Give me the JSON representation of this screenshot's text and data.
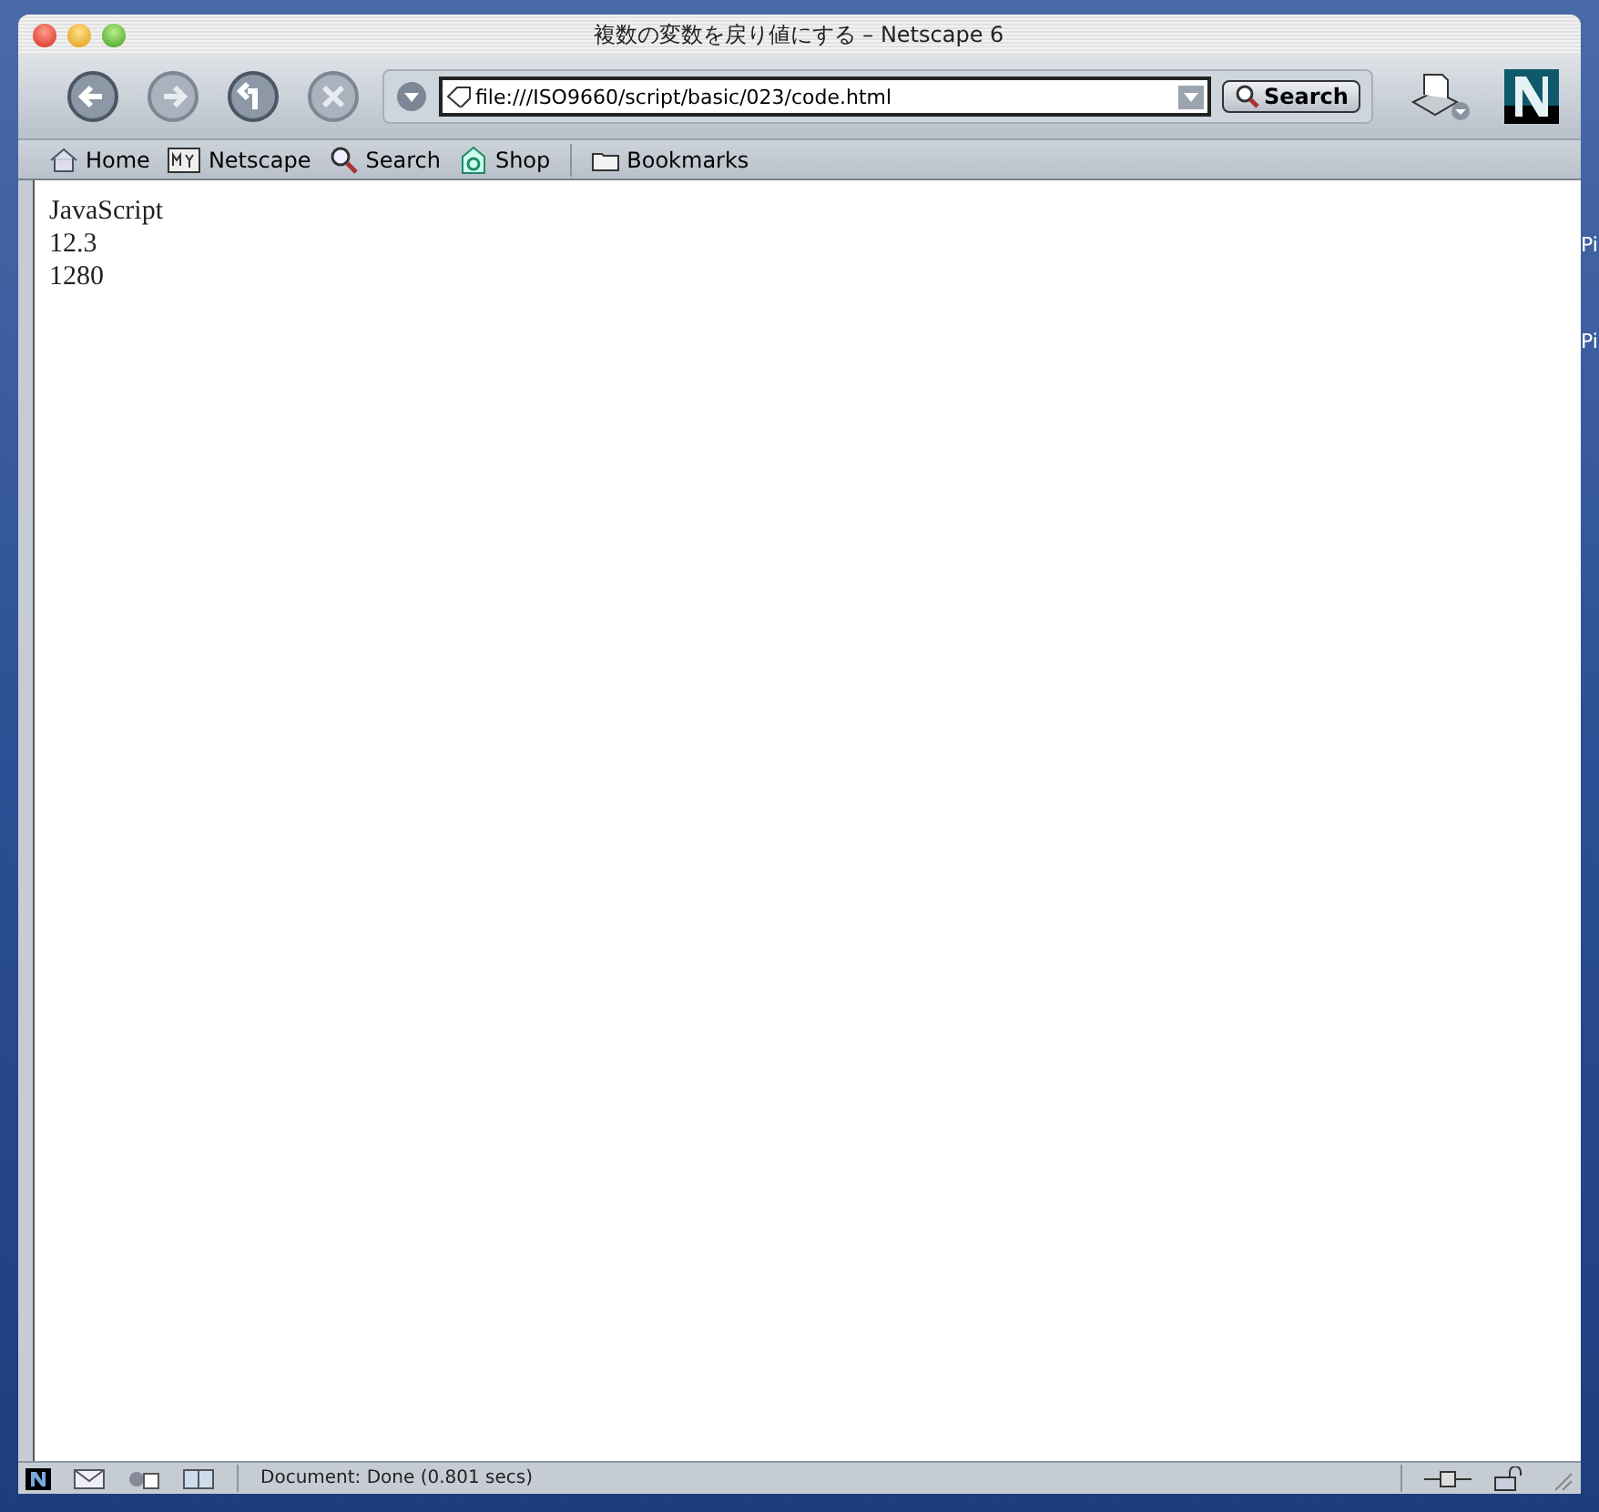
{
  "window": {
    "title": "複数の変数を戻り値にする – Netscape 6"
  },
  "toolbar": {
    "address": "file:///ISO9660/script/basic/023/code.html",
    "search_button": "Search"
  },
  "personal_bar": [
    {
      "label": "Home",
      "kind": "home"
    },
    {
      "label": "Netscape",
      "kind": "my"
    },
    {
      "label": "Search",
      "kind": "search"
    },
    {
      "label": "Shop",
      "kind": "shop"
    },
    {
      "label": "Bookmarks",
      "kind": "folder"
    }
  ],
  "content": {
    "lines": [
      "JavaScript",
      "12.3",
      "1280"
    ]
  },
  "status_bar": {
    "text": "Document: Done (0.801 secs)"
  },
  "desktop": {
    "icon_labels": [
      "Pi",
      "Pi"
    ]
  }
}
